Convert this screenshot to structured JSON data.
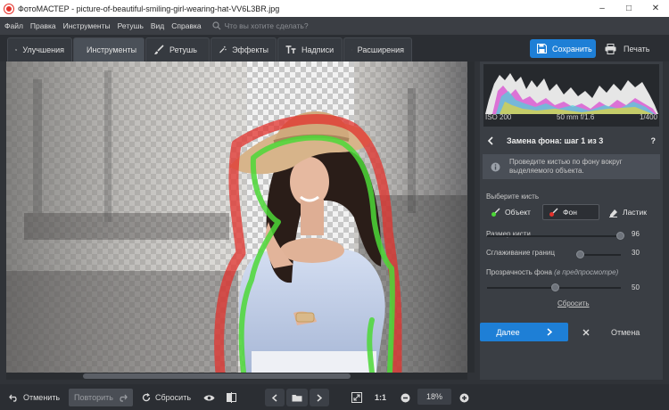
{
  "window": {
    "title": "ФотоМАСТЕР - picture-of-beautiful-smiling-girl-wearing-hat-VV6L3BR.jpg",
    "controls": [
      "–",
      "□",
      "✕"
    ]
  },
  "menu": {
    "items": [
      "Файл",
      "Правка",
      "Инструменты",
      "Ретушь",
      "Вид",
      "Справка"
    ],
    "search_placeholder": "Что вы хотите сделать?"
  },
  "tabs": [
    {
      "label": "Улучшения",
      "icon": "sliders-icon"
    },
    {
      "label": "Инструменты",
      "icon": "crop-icon"
    },
    {
      "label": "Ретушь",
      "icon": "brush-icon"
    },
    {
      "label": "Эффекты",
      "icon": "magic-wand-icon"
    },
    {
      "label": "Надписи",
      "icon": "text-icon"
    },
    {
      "label": "Расширения",
      "icon": "plus-icon"
    }
  ],
  "actions": {
    "save": "Сохранить",
    "print": "Печать"
  },
  "histogram": {
    "iso": "ISO 200",
    "lens": "50 mm f/1.6",
    "shutter": "1/400"
  },
  "panel": {
    "step_title": "Замена фона: шаг 1 из 3",
    "help": "?",
    "hint": "Проведите кистью по фону вокруг выделяемого объекта.",
    "choose_brush": "Выберите кисть",
    "brushes": [
      "Объект",
      "Фон",
      "Ластик"
    ],
    "brush_size_label": "Размер кисти",
    "brush_size_value": "96",
    "smoothing_label": "Сглаживание границ",
    "smoothing_value": "30",
    "opacity_label": "Прозрачность фона",
    "opacity_note": "(в предпросмотре)",
    "opacity_value": "50",
    "reset": "Сбросить",
    "next": "Далее",
    "cancel": "Отмена"
  },
  "bottom": {
    "undo": "Отменить",
    "redo": "Повторить",
    "reset": "Сбросить",
    "ratio": "1:1",
    "zoom": "18%"
  },
  "colors": {
    "accent": "#1e7fd6",
    "object_stroke": "#4cd837",
    "background_stroke": "#e2312c"
  }
}
